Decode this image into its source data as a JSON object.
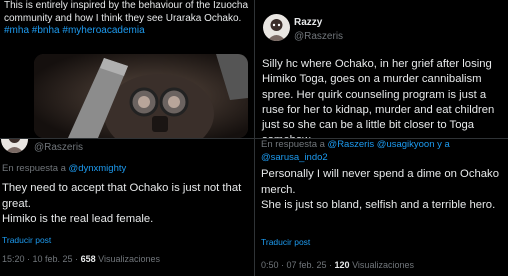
{
  "top_left": {
    "text": "This is entirely inspired by the behaviour of the Izuocha community and how I think they see Uraraka Ochako.",
    "hashtags": [
      "#mha",
      "#bnha",
      "#myheroacademia"
    ]
  },
  "top_right": {
    "display_name": "Razzy",
    "handle": "@Raszeris",
    "body": "Silly hc where Ochako, in her grief after losing Himiko Toga, goes on a murder cannibalism spree. Her quirk counseling program is just a ruse for her to kidnap, murder and eat children just so she can be a little bit closer to Toga somehow."
  },
  "bottom_left": {
    "handle": "@Raszeris",
    "reply_prefix": "En respuesta a",
    "reply_to": "@dynxmighty",
    "body_line1": "They need to accept that Ochako is just not that great.",
    "body_line2": "Himiko is the real lead female.",
    "translate": "Traducir post",
    "timestamp": "15:20 · 10 feb. 25 · ",
    "views_count": "658",
    "views_label": "Visualizaciones"
  },
  "bottom_right": {
    "reply_prefix": "En respuesta a",
    "reply_to_1": "@Raszeris",
    "reply_to_2": "@usagikyoon",
    "reply_conj": "y a",
    "reply_to_3": "@sarusa_indo2",
    "body_line1": "Personally I will never spend a dime on Ochako merch.",
    "body_line2": "She is just so bland, selfish and a terrible hero.",
    "translate": "Traducir post",
    "timestamp": "0:50 · 07 feb. 25 · ",
    "views_count": "120",
    "views_label": "Visualizaciones"
  },
  "colors": {
    "link": "#1d9bf0",
    "muted": "#71767b",
    "text": "#e7e9ea",
    "background": "#000000"
  }
}
